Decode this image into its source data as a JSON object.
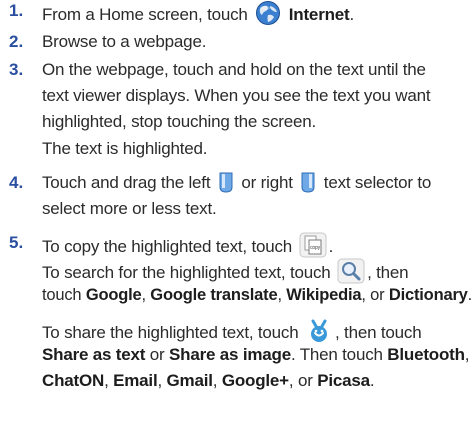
{
  "steps": [
    {
      "num": "1.",
      "lines": [
        {
          "parts": [
            "From a Home screen, touch",
            "Internet",
            "."
          ]
        }
      ]
    },
    {
      "num": "2.",
      "lines": [
        {
          "parts": [
            "Browse to a webpage."
          ]
        }
      ]
    },
    {
      "num": "3.",
      "lines": [
        {
          "parts": [
            "On the webpage, touch and hold on the text until the"
          ]
        },
        {
          "parts": [
            "text viewer displays. When you see the text you want"
          ]
        },
        {
          "parts": [
            "highlighted, stop touching the screen."
          ]
        },
        {
          "parts": [
            "The text is highlighted."
          ]
        }
      ]
    },
    {
      "num": "4.",
      "lines": [
        {
          "parts": [
            "Touch and drag the left",
            "or right",
            "text selector to"
          ]
        },
        {
          "parts": [
            "select more or less text."
          ]
        }
      ]
    },
    {
      "num": "5.",
      "lines": [
        {
          "parts": [
            "To copy the highlighted text, touch",
            "."
          ]
        },
        {
          "parts": [
            "To search for the highlighted text, touch",
            ", then"
          ]
        },
        {
          "parts": [
            "touch ",
            "Google",
            ", ",
            "Google translate",
            ", ",
            "Wikipedia",
            ", or ",
            "Dictionary",
            "."
          ]
        },
        {
          "parts": [
            "To share the highlighted text, touch",
            ", then touch"
          ]
        },
        {
          "parts": [
            "Share as text",
            " or ",
            "Share as image",
            ". Then touch ",
            "Bluetooth",
            ","
          ]
        },
        {
          "parts": [
            "ChatON",
            ", ",
            "Email",
            ", ",
            "Gmail",
            ", ",
            "Google+",
            ", or ",
            "Picasa",
            "."
          ]
        }
      ]
    }
  ],
  "icons": {
    "internet": "globe-icon",
    "left_selector": "left-text-selector-icon",
    "right_selector": "right-text-selector-icon",
    "copy": "copy-icon",
    "copy_label": "copy",
    "search": "search-icon",
    "share": "share-icon"
  }
}
